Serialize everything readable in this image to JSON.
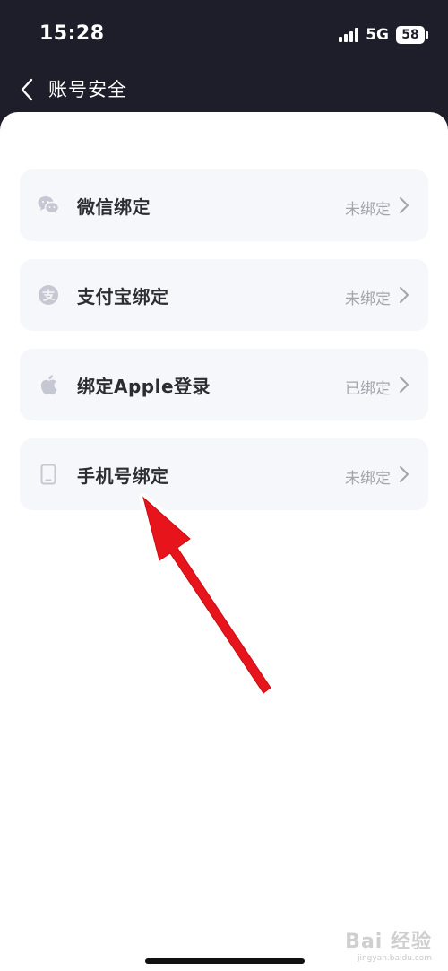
{
  "status_bar": {
    "time": "15:28",
    "network": "5G",
    "battery": "58"
  },
  "nav": {
    "title": "账号安全"
  },
  "bindings": [
    {
      "icon": "wechat-icon",
      "label": "微信绑定",
      "status": "未绑定"
    },
    {
      "icon": "alipay-icon",
      "label": "支付宝绑定",
      "status": "未绑定"
    },
    {
      "icon": "apple-icon",
      "label": "绑定Apple登录",
      "status": "已绑定"
    },
    {
      "icon": "phone-icon",
      "label": "手机号绑定",
      "status": "未绑定"
    }
  ],
  "colors": {
    "header_bg": "#1e1e2a",
    "row_bg": "#f6f7fa",
    "label": "#2c2c33",
    "status": "#a3a5ad",
    "icon": "#c5c8d2",
    "annotation_arrow": "#e8141c"
  },
  "watermark": {
    "logo": "Bai 经验",
    "url": "jingyan.baidu.com"
  }
}
